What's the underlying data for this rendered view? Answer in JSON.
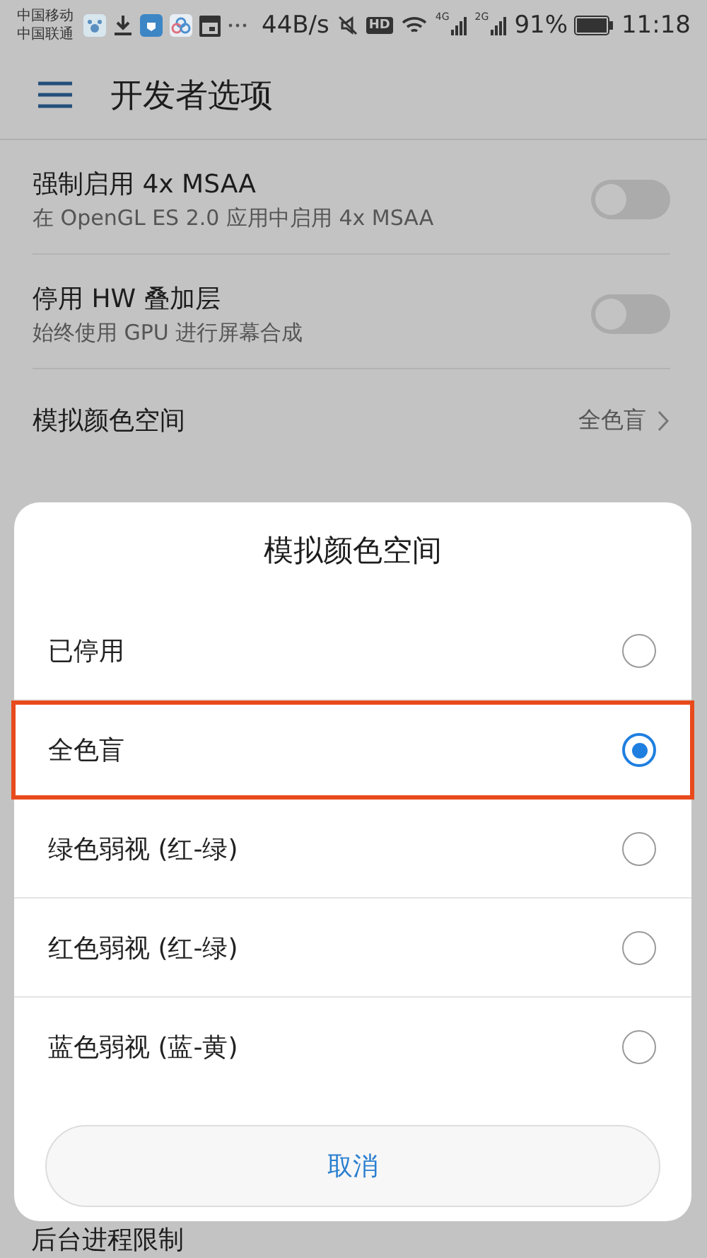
{
  "status_bar": {
    "carriers": [
      "中国移动",
      "中国联通"
    ],
    "speed": "44B/s",
    "hd": "HD",
    "net1": "4G",
    "net2": "2G",
    "battery": "91%",
    "time": "11:18"
  },
  "app_bar": {
    "title": "开发者选项"
  },
  "settings": [
    {
      "kind": "toggle",
      "title": "强制启用 4x MSAA",
      "subtitle": "在 OpenGL ES 2.0 应用中启用 4x MSAA",
      "on": false
    },
    {
      "kind": "toggle",
      "title": "停用 HW 叠加层",
      "subtitle": "始终使用 GPU 进行屏幕合成",
      "on": false
    },
    {
      "kind": "value",
      "title": "模拟颜色空间",
      "value": "全色盲"
    }
  ],
  "dialog": {
    "title": "模拟颜色空间",
    "options": [
      {
        "label": "已停用",
        "selected": false
      },
      {
        "label": "全色盲",
        "selected": true
      },
      {
        "label": "绿色弱视 (红-绿)",
        "selected": false
      },
      {
        "label": "红色弱视 (红-绿)",
        "selected": false
      },
      {
        "label": "蓝色弱视 (蓝-黄)",
        "selected": false
      }
    ],
    "cancel": "取消"
  },
  "behind_item": "后台进程限制"
}
